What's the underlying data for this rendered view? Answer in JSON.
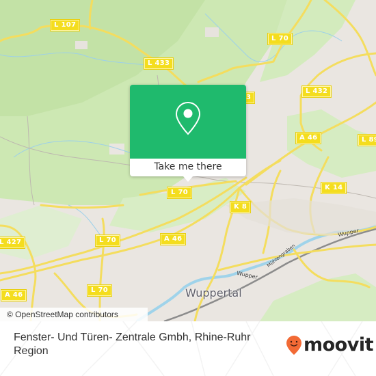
{
  "map": {
    "road_labels": [
      {
        "id": "l107",
        "text": "L 107"
      },
      {
        "id": "l433",
        "text": "L 433"
      },
      {
        "id": "l70_top",
        "text": "L 70"
      },
      {
        "id": "l432",
        "text": "L 432"
      },
      {
        "id": "l89",
        "text": "L 89"
      },
      {
        "id": "a46_right",
        "text": "A 46"
      },
      {
        "id": "l70_mid",
        "text": "L 70"
      },
      {
        "id": "k8",
        "text": "K 8"
      },
      {
        "id": "k14",
        "text": "K 14"
      },
      {
        "id": "l427",
        "text": "L 427"
      },
      {
        "id": "l70_left",
        "text": "L 70"
      },
      {
        "id": "a46_mid",
        "text": "A 46"
      },
      {
        "id": "a46_left",
        "text": "A 46"
      },
      {
        "id": "l70_bottom",
        "text": "L 70"
      },
      {
        "id": "l433_partial",
        "text": "3"
      }
    ],
    "city_label": "Wuppertal",
    "river_labels": [
      "Wupper",
      "Wupper",
      "Mühlengraben"
    ],
    "attribution": "© OpenStreetMap contributors"
  },
  "popup": {
    "icon": "map-pin-icon",
    "button_label": "Take me there",
    "accent_color": "#1fba6d"
  },
  "footer": {
    "place_title": "Fenster- Und Türen- Zentrale Gmbh, Rhine-Ruhr Region",
    "brand": "moovit",
    "brand_color": "#f26a35"
  }
}
